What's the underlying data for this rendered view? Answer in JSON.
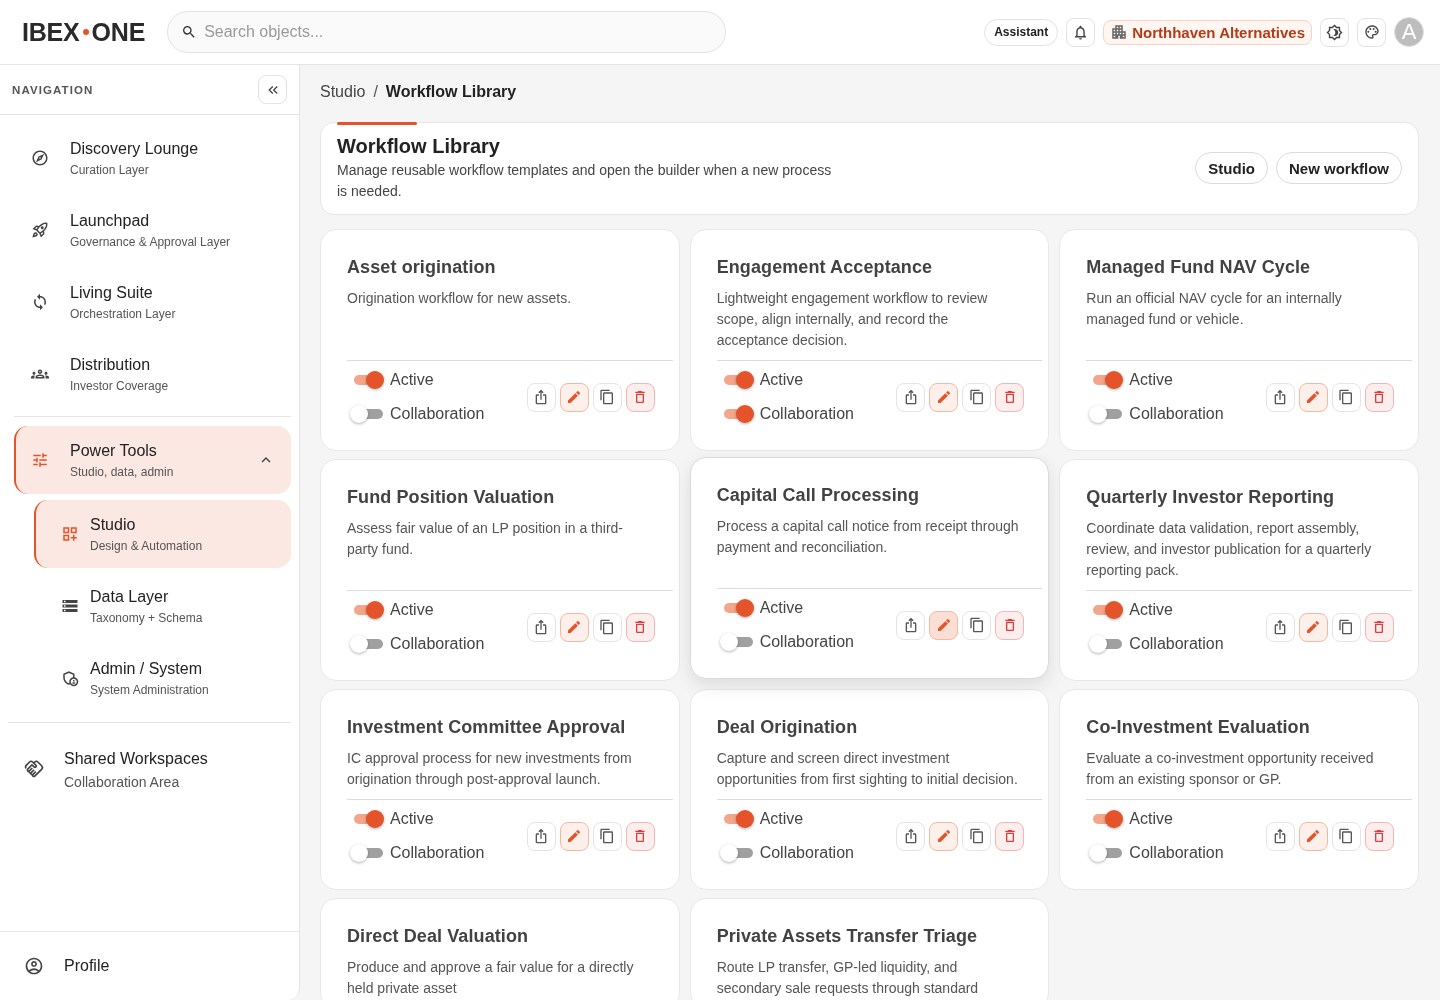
{
  "brand": {
    "left": "IBEX",
    "right": "ONE"
  },
  "search": {
    "placeholder": "Search objects..."
  },
  "top_actions": {
    "assistant": "Assistant",
    "organization": "Northhaven Alternatives",
    "avatar_initial": "A"
  },
  "sidebar": {
    "title": "NAVIGATION",
    "sections": [
      {
        "items": [
          {
            "title": "Discovery Lounge",
            "subtitle": "Curation Layer",
            "selected": false
          },
          {
            "title": "Launchpad",
            "subtitle": "Governance & Approval Layer",
            "selected": false
          },
          {
            "title": "Living Suite",
            "subtitle": "Orchestration Layer",
            "selected": false
          },
          {
            "title": "Distribution",
            "subtitle": "Investor Coverage",
            "selected": false
          }
        ]
      },
      {
        "items": [
          {
            "title": "Power Tools",
            "subtitle": "Studio, data, admin",
            "selected": true,
            "expanded": true,
            "children": [
              {
                "title": "Studio",
                "subtitle": "Design & Automation",
                "selected": true
              },
              {
                "title": "Data Layer",
                "subtitle": "Taxonomy + Schema",
                "selected": false
              },
              {
                "title": "Admin / System",
                "subtitle": "System Administration",
                "selected": false
              }
            ]
          }
        ]
      },
      {
        "items": [
          {
            "title": "Shared Workspaces",
            "subtitle": "Collaboration Area",
            "selected": false
          }
        ]
      }
    ],
    "profile": "Profile"
  },
  "breadcrumb": {
    "separator": "/",
    "items": [
      {
        "label": "Studio",
        "current": false
      },
      {
        "label": "Workflow Library",
        "current": true
      }
    ]
  },
  "page_header": {
    "title": "Workflow Library",
    "description": "Manage reusable workflow templates and open the builder when a new process is needed.",
    "buttons": [
      "Studio",
      "New workflow"
    ]
  },
  "workflows": [
    {
      "title": "Asset origination",
      "description": "Origination workflow for new assets.",
      "highlighted": false,
      "toggles": [
        {
          "label": "Active",
          "on": true
        },
        {
          "label": "Collaboration",
          "on": false
        }
      ]
    },
    {
      "title": "Engagement Acceptance",
      "description": "Lightweight engagement workflow to review scope, align internally, and record the acceptance decision.",
      "highlighted": false,
      "toggles": [
        {
          "label": "Active",
          "on": true
        },
        {
          "label": "Collaboration",
          "on": true
        }
      ]
    },
    {
      "title": "Managed Fund NAV Cycle",
      "description": "Run an official NAV cycle for an internally managed fund or vehicle.",
      "highlighted": false,
      "toggles": [
        {
          "label": "Active",
          "on": true
        },
        {
          "label": "Collaboration",
          "on": false
        }
      ]
    },
    {
      "title": "Fund Position Valuation",
      "description": "Assess fair value of an LP position in a third-party fund.",
      "highlighted": false,
      "toggles": [
        {
          "label": "Active",
          "on": true
        },
        {
          "label": "Collaboration",
          "on": false
        }
      ]
    },
    {
      "title": "Capital Call Processing",
      "description": "Process a capital call notice from receipt through payment and reconciliation.",
      "highlighted": true,
      "toggles": [
        {
          "label": "Active",
          "on": true
        },
        {
          "label": "Collaboration",
          "on": false
        }
      ]
    },
    {
      "title": "Quarterly Investor Reporting",
      "description": "Coordinate data validation, report assembly, review, and investor publication for a quarterly reporting pack.",
      "highlighted": false,
      "toggles": [
        {
          "label": "Active",
          "on": true
        },
        {
          "label": "Collaboration",
          "on": false
        }
      ]
    },
    {
      "title": "Investment Committee Approval",
      "description": "IC approval process for new investments from origination through post-approval launch.",
      "highlighted": false,
      "toggles": [
        {
          "label": "Active",
          "on": true
        },
        {
          "label": "Collaboration",
          "on": false
        }
      ]
    },
    {
      "title": "Deal Origination",
      "description": "Capture and screen direct investment opportunities from first sighting to initial decision.",
      "highlighted": false,
      "toggles": [
        {
          "label": "Active",
          "on": true
        },
        {
          "label": "Collaboration",
          "on": false
        }
      ]
    },
    {
      "title": "Co-Investment Evaluation",
      "description": "Evaluate a co-investment opportunity received from an existing sponsor or GP.",
      "highlighted": false,
      "toggles": [
        {
          "label": "Active",
          "on": true
        },
        {
          "label": "Collaboration",
          "on": false
        }
      ]
    },
    {
      "title": "Direct Deal Valuation",
      "description": "Produce and approve a fair value for a directly held private asset",
      "highlighted": false
    },
    {
      "title": "Private Assets Transfer Triage",
      "description": "Route LP transfer, GP-led liquidity, and secondary sale requests through standard",
      "highlighted": false
    }
  ]
}
